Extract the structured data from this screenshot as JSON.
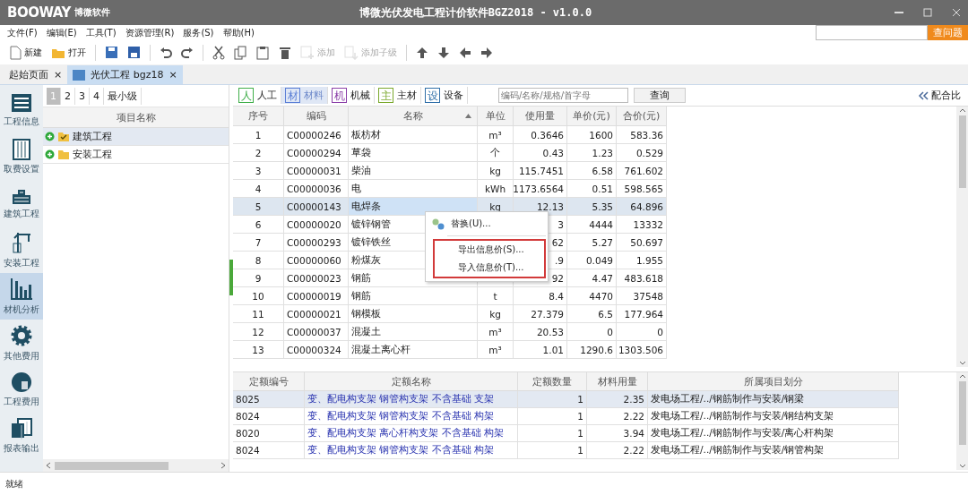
{
  "window": {
    "logo": "BOOWAY",
    "brand": "博微软件",
    "title": "博微光伏发电工程计价软件BGZ2018 - v1.0.0"
  },
  "menu": [
    "文件(F)",
    "编辑(E)",
    "工具(T)",
    "资源管理(R)",
    "服务(S)",
    "帮助(H)"
  ],
  "help_search": {
    "button": "查问题"
  },
  "toolbar": [
    {
      "kind": "new",
      "label": "新建",
      "disabled": false
    },
    {
      "kind": "open",
      "label": "打开",
      "disabled": false
    },
    {
      "kind": "save",
      "disabled": false
    },
    {
      "kind": "save-all",
      "disabled": false
    },
    {
      "kind": "undo",
      "disabled": false
    },
    {
      "kind": "redo",
      "disabled": false
    },
    {
      "kind": "cut",
      "disabled": false
    },
    {
      "kind": "copy",
      "disabled": false
    },
    {
      "kind": "paste",
      "disabled": false
    },
    {
      "kind": "delete",
      "disabled": false
    },
    {
      "kind": "add",
      "label": "添加",
      "disabled": true
    },
    {
      "kind": "add-child",
      "label": "添加子级",
      "disabled": true
    },
    {
      "kind": "up",
      "disabled": false
    },
    {
      "kind": "down",
      "disabled": false
    },
    {
      "kind": "left",
      "disabled": false
    },
    {
      "kind": "right",
      "disabled": false
    }
  ],
  "doc_tabs": [
    {
      "label": "起始页面",
      "close": "×",
      "selected": false
    },
    {
      "label": "光伏工程 bgz18",
      "close": "×",
      "selected": true
    }
  ],
  "nav": [
    {
      "kind": "info",
      "label": "工程信息",
      "selected": false
    },
    {
      "kind": "fees",
      "label": "取费设置",
      "selected": false
    },
    {
      "kind": "building",
      "label": "建筑工程",
      "selected": false
    },
    {
      "kind": "install",
      "label": "安装工程",
      "selected": false
    },
    {
      "kind": "analysis",
      "label": "材机分析",
      "selected": true
    },
    {
      "kind": "other",
      "label": "其他费用",
      "selected": false
    },
    {
      "kind": "cost",
      "label": "工程费用",
      "selected": false
    },
    {
      "kind": "report",
      "label": "报表输出",
      "selected": false
    }
  ],
  "levels": [
    {
      "label": "1",
      "selected": true
    },
    {
      "label": "2",
      "selected": false
    },
    {
      "label": "3",
      "selected": false
    },
    {
      "label": "4",
      "selected": false
    },
    {
      "label": "最小级",
      "selected": false
    }
  ],
  "tree": {
    "header": "项目名称",
    "items": [
      {
        "label": "建筑工程",
        "selected": true,
        "checked": true
      },
      {
        "label": "安装工程",
        "selected": false,
        "checked": false
      }
    ]
  },
  "filters": [
    {
      "glyph": "人",
      "label": "人工",
      "color": "#3fae49",
      "selected": false
    },
    {
      "glyph": "材",
      "label": "材料",
      "color": "#5b7fd6",
      "selected": true
    },
    {
      "glyph": "机",
      "label": "机械",
      "color": "#8b3fa8",
      "selected": false
    },
    {
      "glyph": "主",
      "label": "主材",
      "color": "#7aa82c",
      "selected": false
    },
    {
      "glyph": "设",
      "label": "设备",
      "color": "#2f6fa8",
      "selected": false
    }
  ],
  "search": {
    "placeholder": "编码/名称/规格/首字母"
  },
  "query_button": "查询",
  "mix_ratio": "配合比",
  "materials": {
    "columns": [
      {
        "label": "序号",
        "sorted": false
      },
      {
        "label": "编码",
        "sorted": false
      },
      {
        "label": "名称",
        "sorted": true
      },
      {
        "label": "单位",
        "sorted": false
      },
      {
        "label": "使用量",
        "sorted": false
      },
      {
        "label": "单价(元)",
        "sorted": false
      },
      {
        "label": "合价(元)",
        "sorted": false
      }
    ],
    "rows": [
      {
        "selected": false,
        "cells": [
          "1",
          "C00000246",
          "板枋材",
          "m³",
          "0.3646",
          "1600",
          "583.36"
        ]
      },
      {
        "selected": false,
        "cells": [
          "2",
          "C00000294",
          "草袋",
          "个",
          "0.43",
          "1.23",
          "0.529"
        ]
      },
      {
        "selected": false,
        "cells": [
          "3",
          "C00000031",
          "柴油",
          "kg",
          "115.7451",
          "6.58",
          "761.602"
        ]
      },
      {
        "selected": false,
        "cells": [
          "4",
          "C00000036",
          "电",
          "kWh",
          "1173.6564",
          "0.51",
          "598.565"
        ]
      },
      {
        "selected": true,
        "cells": [
          "5",
          "C00000143",
          "电焊条",
          "kg",
          "12.13",
          "5.35",
          "64.896"
        ]
      },
      {
        "selected": false,
        "cells": [
          "6",
          "C00000020",
          "镀锌钢管",
          "",
          "3",
          "4444",
          "13332"
        ]
      },
      {
        "selected": false,
        "cells": [
          "7",
          "C00000293",
          "镀锌铁丝",
          "",
          "62",
          "5.27",
          "50.697"
        ]
      },
      {
        "selected": false,
        "cells": [
          "8",
          "C00000060",
          "粉煤灰",
          "",
          ".9",
          "0.049",
          "1.955"
        ]
      },
      {
        "selected": false,
        "cells": [
          "9",
          "C00000023",
          "钢筋",
          "",
          "92",
          "4.47",
          "483.618"
        ]
      },
      {
        "selected": false,
        "cells": [
          "10",
          "C00000019",
          "钢筋",
          "t",
          "8.4",
          "4470",
          "37548"
        ]
      },
      {
        "selected": false,
        "cells": [
          "11",
          "C00000021",
          "钢模板",
          "kg",
          "27.379",
          "6.5",
          "177.964"
        ]
      },
      {
        "selected": false,
        "cells": [
          "12",
          "C00000037",
          "混凝土",
          "m³",
          "20.53",
          "0",
          "0"
        ]
      },
      {
        "selected": false,
        "cells": [
          "13",
          "C00000324",
          "混凝土离心杆",
          "m³",
          "1.01",
          "1290.6",
          "1303.506"
        ]
      }
    ]
  },
  "context_menu": [
    {
      "kind": "replace",
      "label": "替换(U)...",
      "highlighted": false
    },
    {
      "kind": "export",
      "label": "导出信息价(S)...",
      "highlighted": true
    },
    {
      "kind": "import",
      "label": "导入信息价(T)...",
      "highlighted": true
    }
  ],
  "quotas": {
    "columns": [
      "定额编号",
      "定额名称",
      "定额数量",
      "材料用量",
      "所属项目划分"
    ],
    "rows": [
      {
        "selected": true,
        "cells": [
          "8025",
          "变、配电构支架 钢管构支架 不含基础 支架",
          "1",
          "2.35",
          "发电场工程/../钢筋制作与安装/钢梁"
        ]
      },
      {
        "selected": false,
        "cells": [
          "8024",
          "变、配电构支架 钢管构支架 不含基础 构架",
          "1",
          "2.22",
          "发电场工程/../钢筋制作与安装/钢结构支架"
        ]
      },
      {
        "selected": false,
        "cells": [
          "8020",
          "变、配电构支架 离心杆构支架 不含基础 构架",
          "1",
          "3.94",
          "发电场工程/../钢筋制作与安装/离心杆构架"
        ]
      },
      {
        "selected": false,
        "cells": [
          "8024",
          "变、配电构支架 钢管构支架 不含基础 构架",
          "1",
          "2.22",
          "发电场工程/../钢筋制作与安装/钢管构架"
        ]
      }
    ]
  },
  "status_bar": "就绪"
}
